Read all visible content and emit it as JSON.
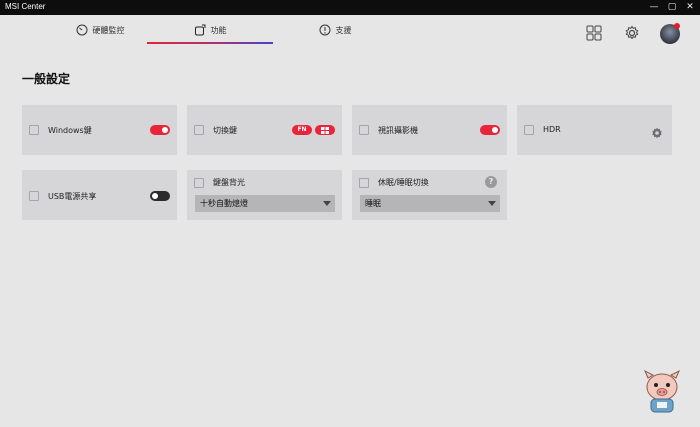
{
  "window": {
    "title": "MSI Center",
    "min_glyph": "—",
    "max_glyph": "▢",
    "close_glyph": "✕"
  },
  "tabs": [
    {
      "label": "硬體監控",
      "icon": "speedometer-icon"
    },
    {
      "label": "功能",
      "icon": "feature-icon",
      "active": true
    },
    {
      "label": "支援",
      "icon": "support-icon"
    }
  ],
  "header_icons": [
    "apps-grid-icon",
    "settings-gear-icon",
    "user-avatar"
  ],
  "section": {
    "title": "一般設定"
  },
  "cards": {
    "windows_key": {
      "label": "Windows鍵",
      "toggle": "on"
    },
    "switch_key": {
      "label": "切換鍵",
      "fn_badge": "FN",
      "win_badge": "windows-logo-icon"
    },
    "webcam": {
      "label": "視訊攝影機",
      "toggle": "on"
    },
    "hdr": {
      "label": "HDR",
      "icon": "gear-icon"
    },
    "usb_power_share": {
      "label": "USB電源共享",
      "toggle": "off"
    },
    "kb_backlight": {
      "label": "鍵盤背光",
      "dropdown_value": "十秒自動熄燈"
    },
    "sleep_switch": {
      "label": "休眠/睡眠切換",
      "help": "?",
      "dropdown_value": "睡眠"
    }
  },
  "colors": {
    "accent": "#e8253a",
    "background": "#e6e6e7",
    "card": "#d6d6d8",
    "titlebar": "#0d0d0d"
  }
}
